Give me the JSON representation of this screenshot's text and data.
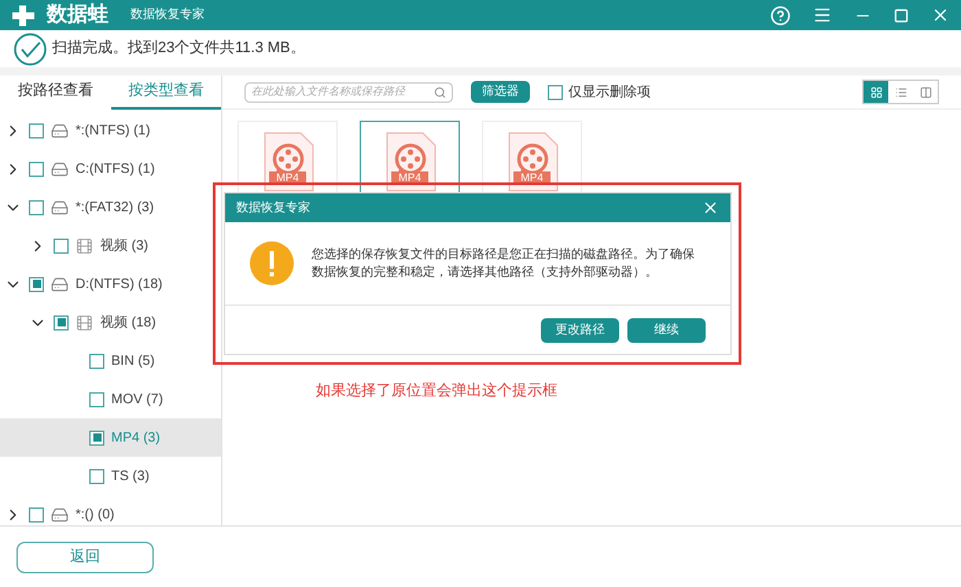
{
  "window": {
    "logo_text": "数据蛙",
    "title": "数据恢复专家"
  },
  "status": "扫描完成。找到23个文件共11.3 MB。",
  "view_tabs": [
    {
      "label": "按路径查看",
      "selected": false
    },
    {
      "label": "按类型查看",
      "selected": true
    }
  ],
  "toolbar": {
    "search": {
      "placeholder": "在此处输入文件名称或保存路径"
    },
    "filter_button": "筛选器",
    "deleted_only": {
      "label": "仅显示删除项",
      "checked": false
    },
    "view_modes": [
      {
        "kind": "grid",
        "selected": true
      },
      {
        "kind": "list",
        "selected": false
      },
      {
        "kind": "detail",
        "selected": false
      }
    ]
  },
  "tree": [
    {
      "kind": "drive",
      "label": "*:(NTFS) (1)",
      "checked": false,
      "expanded": false,
      "selected": false
    },
    {
      "kind": "drive",
      "label": "C:(NTFS) (1)",
      "checked": false,
      "expanded": false,
      "selected": false
    },
    {
      "kind": "drive",
      "label": "*:(FAT32) (3)",
      "checked": false,
      "expanded": true,
      "selected": false,
      "children": [
        {
          "kind": "video",
          "label": "视频 (3)",
          "checked": false,
          "expanded": false,
          "selected": false
        }
      ]
    },
    {
      "kind": "drive",
      "label": "D:(NTFS) (18)",
      "checked": true,
      "expanded": true,
      "selected": false,
      "children": [
        {
          "kind": "video",
          "label": "视频 (18)",
          "checked": true,
          "expanded": true,
          "selected": false,
          "children": [
            {
              "kind": "type",
              "label": "BIN (5)",
              "checked": false,
              "selected": false
            },
            {
              "kind": "type",
              "label": "MOV (7)",
              "checked": false,
              "selected": false
            },
            {
              "kind": "type",
              "label": "MP4 (3)",
              "checked": true,
              "selected": true
            },
            {
              "kind": "type",
              "label": "TS (3)",
              "checked": false,
              "selected": false
            }
          ]
        }
      ]
    },
    {
      "kind": "drive",
      "label": "*:() (0)",
      "checked": false,
      "expanded": false,
      "selected": false
    }
  ],
  "files": [
    {
      "type": "MP4",
      "selected": false
    },
    {
      "type": "MP4",
      "selected": true
    },
    {
      "type": "MP4",
      "selected": false
    }
  ],
  "dialog": {
    "title": "数据恢复专家",
    "message": "您选择的保存恢复文件的目标路径是您正在扫描的磁盘路径。为了确保数据恢复的完整和稳定，请选择其他路径（支持外部驱动器）。",
    "buttons": [
      "更改路径",
      "继续"
    ]
  },
  "annotation": "如果选择了原位置会弹出这个提示框",
  "back_button": "返回"
}
